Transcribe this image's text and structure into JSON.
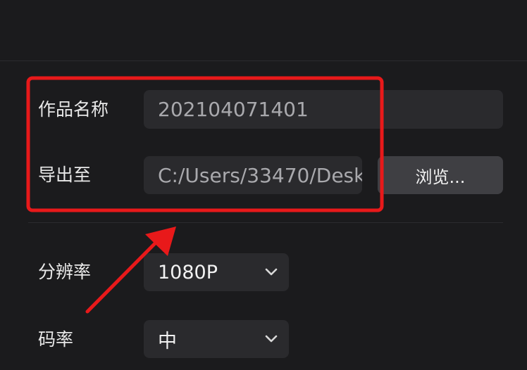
{
  "export_form": {
    "name_label": "作品名称",
    "name_value": "202104071401",
    "export_label": "导出至",
    "export_path": "C:/Users/33470/Desk",
    "browse_label": "浏览...",
    "resolution_label": "分辨率",
    "resolution_value": "1080P",
    "bitrate_label": "码率",
    "bitrate_value": "中"
  },
  "annotation_color": "#e8191a",
  "icons": [
    "chevron-down-icon",
    "chevron-down-icon"
  ]
}
